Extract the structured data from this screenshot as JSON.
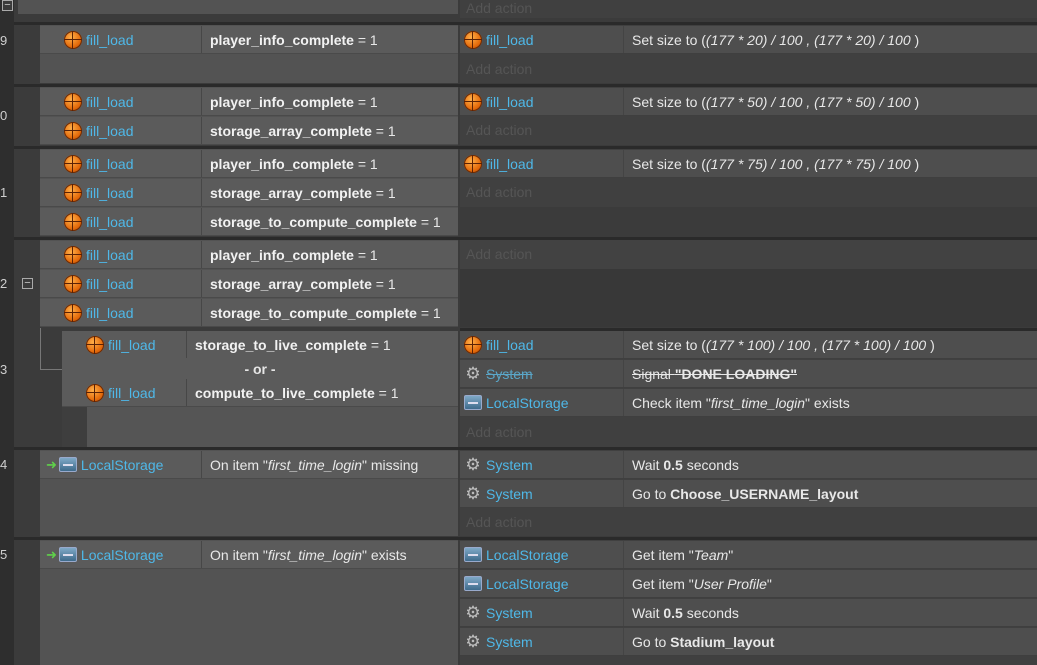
{
  "add_action_label": "Add action",
  "events": [
    {
      "number": "9",
      "conditions": [
        {
          "object": "fill_load",
          "var": "player_info_complete",
          "op": "= 1"
        }
      ],
      "actions": [
        {
          "object": "fill_load",
          "text_prefix": "Set size to (",
          "text_expr": "(177 * 20) / 100 , (177 * 20) / 100",
          "text_suffix": " )"
        }
      ]
    },
    {
      "number": "0",
      "conditions": [
        {
          "object": "fill_load",
          "var": "player_info_complete",
          "op": "= 1"
        },
        {
          "object": "fill_load",
          "var": "storage_array_complete",
          "op": "= 1"
        }
      ],
      "actions": [
        {
          "object": "fill_load",
          "text_prefix": "Set size to (",
          "text_expr": "(177 * 50) / 100 , (177 * 50) / 100",
          "text_suffix": " )"
        }
      ]
    },
    {
      "number": "1",
      "conditions": [
        {
          "object": "fill_load",
          "var": "player_info_complete",
          "op": "= 1"
        },
        {
          "object": "fill_load",
          "var": "storage_array_complete",
          "op": "= 1"
        },
        {
          "object": "fill_load",
          "var": "storage_to_compute_complete",
          "op": "= 1"
        }
      ],
      "actions": [
        {
          "object": "fill_load",
          "text_prefix": "Set size to (",
          "text_expr": "(177 * 75) / 100 , (177 * 75) / 100",
          "text_suffix": " )"
        }
      ]
    },
    {
      "number": "2",
      "conditions": [
        {
          "object": "fill_load",
          "var": "player_info_complete",
          "op": "= 1"
        },
        {
          "object": "fill_load",
          "var": "storage_array_complete",
          "op": "= 1"
        },
        {
          "object": "fill_load",
          "var": "storage_to_compute_complete",
          "op": "= 1"
        }
      ],
      "actions": []
    },
    {
      "number": "3",
      "or_label": "- or -",
      "conditions": [
        {
          "object": "fill_load",
          "var": "storage_to_live_complete",
          "op": "= 1"
        },
        {
          "object": "fill_load",
          "var": "compute_to_live_complete",
          "op": "= 1"
        }
      ],
      "actions": [
        {
          "object": "fill_load",
          "text_prefix": "Set size to (",
          "text_expr": "(177 * 100) / 100 , (177 * 100) / 100",
          "text_suffix": " )"
        },
        {
          "object": "System",
          "signal_label": "Signal",
          "signal_value": "\"DONE LOADING\""
        },
        {
          "object": "LocalStorage",
          "pre": "Check item \"",
          "key": "first_time_login",
          "post": "\" exists"
        }
      ]
    },
    {
      "number": "4",
      "conditions": [
        {
          "object": "LocalStorage",
          "pre": "On item \"",
          "key": "first_time_login",
          "post": "\" missing"
        }
      ],
      "actions": [
        {
          "object": "System",
          "pre": "Wait ",
          "bold": "0.5",
          "post": " seconds"
        },
        {
          "object": "System",
          "pre": "Go to ",
          "bold": "Choose_USERNAME_layout",
          "post": ""
        }
      ]
    },
    {
      "number": "5",
      "conditions": [
        {
          "object": "LocalStorage",
          "pre": "On item \"",
          "key": "first_time_login",
          "post": "\" exists"
        }
      ],
      "actions": [
        {
          "object": "LocalStorage",
          "pre": "Get item \"",
          "key": "Team",
          "post": "\""
        },
        {
          "object": "LocalStorage",
          "pre": "Get item \"",
          "key": "User Profile",
          "post": "\""
        },
        {
          "object": "System",
          "pre": "Wait ",
          "bold": "0.5",
          "post": " seconds"
        },
        {
          "object": "System",
          "pre": "Go to ",
          "bold": "Stadium_layout",
          "post": ""
        }
      ]
    }
  ]
}
